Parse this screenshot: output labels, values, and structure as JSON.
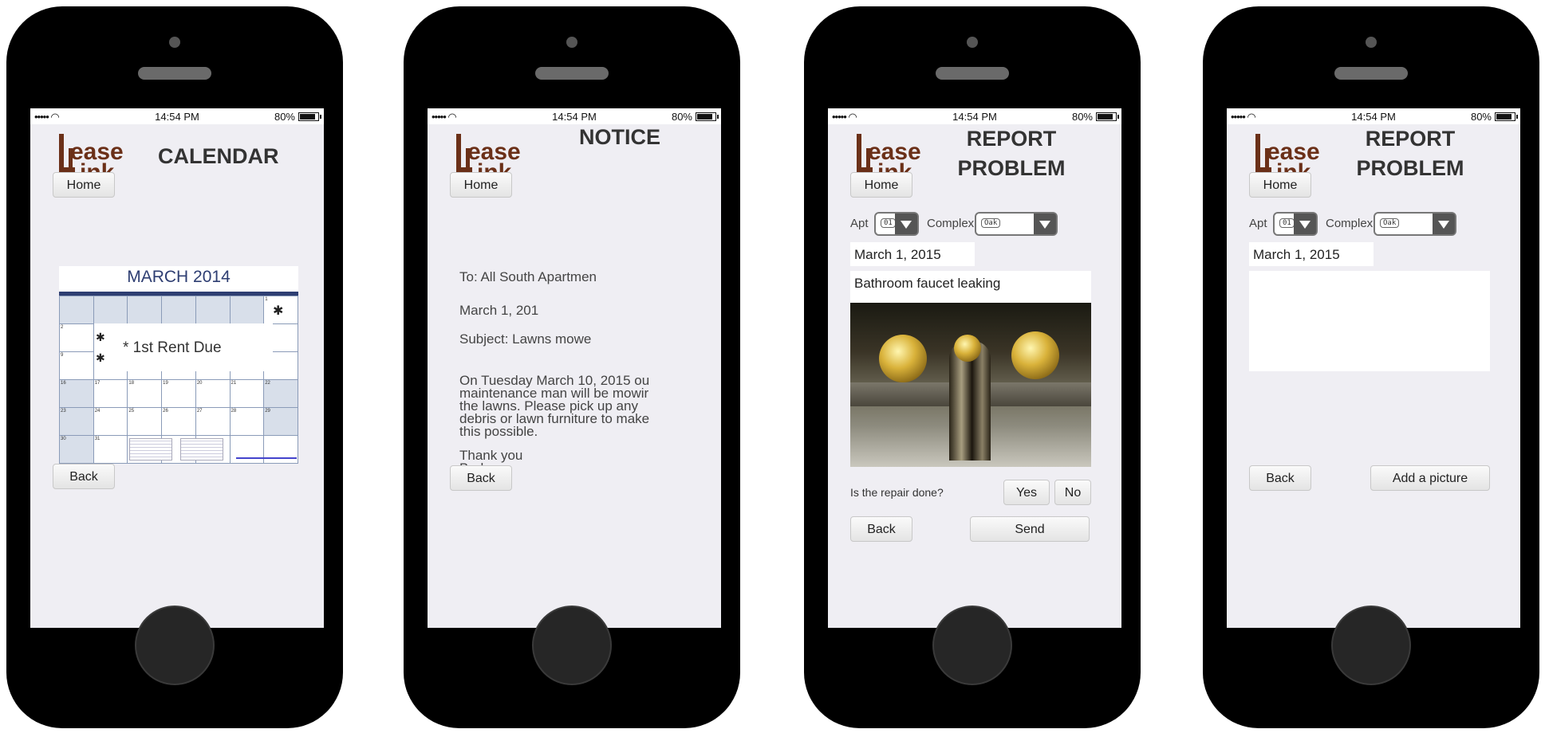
{
  "status_bar": {
    "signal": "••••• ",
    "time": "14:54 PM",
    "battery": "80%"
  },
  "logo": {
    "line1": "ease",
    "line2": "ink"
  },
  "calendar_screen": {
    "title": "CALENDAR",
    "home": "Home",
    "back": "Back",
    "calendar_title": "MARCH  2014",
    "event": "* 1st Rent Due"
  },
  "notice_screen": {
    "title": "NOTICE",
    "home": "Home",
    "back": "Back",
    "to": "To: All South Apartmen",
    "date": "March 1, 201",
    "subject": "Subject: Lawns mowe",
    "body_lines": [
      "On Tuesday March 10, 2015 ou",
      "maintenance man will be mowir",
      "the lawns.  Please pick up any",
      "debris or lawn furniture to make",
      "this possible."
    ],
    "closing_lines": [
      "Thank you",
      "Barbara"
    ]
  },
  "report_screen_1": {
    "title": "REPORT\nPROBLEM",
    "home": "Home",
    "apt_label": "Apt",
    "apt_value": "01",
    "complex_label": "Complex",
    "complex_value": "Oak",
    "date": "March 1, 2015",
    "description": "Bathroom faucet leaking",
    "question": "Is the repair done?",
    "yes": "Yes",
    "no": "No",
    "back": "Back",
    "send": "Send"
  },
  "report_screen_2": {
    "title": "REPORT\nPROBLEM",
    "home": "Home",
    "apt_label": "Apt",
    "apt_value": "01",
    "complex_label": "Complex",
    "complex_value": "Oak",
    "date": "March 1, 2015",
    "description": "",
    "back": "Back",
    "add_picture": "Add a picture"
  }
}
